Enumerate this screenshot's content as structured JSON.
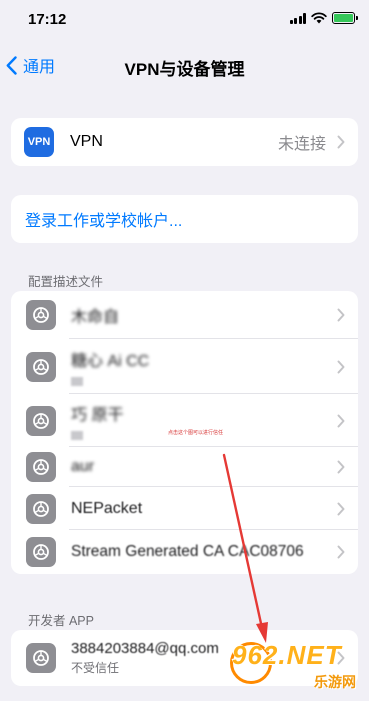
{
  "status_bar": {
    "time": "17:12"
  },
  "nav": {
    "back_label": "通用",
    "title": "VPN与设备管理"
  },
  "vpn": {
    "badge": "VPN",
    "label": "VPN",
    "status": "未连接"
  },
  "signin": {
    "label": "登录工作或学校帐户..."
  },
  "profiles_section": {
    "header": "配置描述文件",
    "items": [
      {
        "name": "木命自"
      },
      {
        "name": "糖心 Ai CC"
      },
      {
        "name": "巧 原干"
      },
      {
        "name": "aur"
      },
      {
        "name": "NEPacket"
      },
      {
        "name": "Stream Generated CA CAC08706"
      }
    ]
  },
  "annotation_note": "点击这个图可以进行信任",
  "developer_section": {
    "header": "开发者 APP",
    "app": {
      "name": "3884203884@qq.com",
      "status": "不受信任"
    }
  },
  "watermark": {
    "logo": "962.NET",
    "sub": "乐游网"
  },
  "colors": {
    "accent": "#007aff",
    "vpn_badge": "#1f6ce1",
    "background": "#f1f0f6",
    "annotation_arrow": "#e53935"
  }
}
